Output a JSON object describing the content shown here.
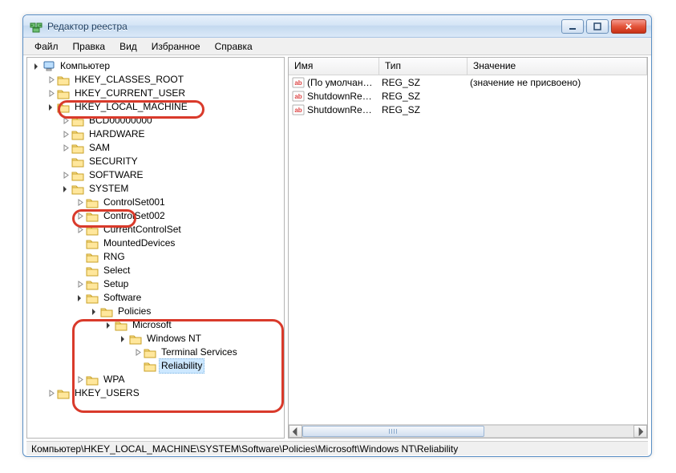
{
  "window": {
    "title": "Редактор реестра"
  },
  "menu": {
    "file": "Файл",
    "edit": "Правка",
    "view": "Вид",
    "favorites": "Избранное",
    "help": "Справка"
  },
  "tree": {
    "root": "Компьютер",
    "hkcr": "HKEY_CLASSES_ROOT",
    "hkcu": "HKEY_CURRENT_USER",
    "hklm": "HKEY_LOCAL_MACHINE",
    "hklm_children": {
      "bcd": "BCD00000000",
      "hardware": "HARDWARE",
      "sam": "SAM",
      "security": "SECURITY",
      "software": "SOFTWARE",
      "system": "SYSTEM"
    },
    "system_children": {
      "cs001": "ControlSet001",
      "cs002": "ControlSet002",
      "ccs": "CurrentControlSet",
      "md": "MountedDevices",
      "rng": "RNG",
      "select": "Select",
      "setup": "Setup",
      "software": "Software",
      "wpa": "WPA"
    },
    "software_children": {
      "policies": "Policies",
      "microsoft": "Microsoft",
      "windowsnt": "Windows NT",
      "ts": "Terminal Services",
      "reliability": "Reliability"
    },
    "hku": "HKEY_USERS"
  },
  "listview": {
    "columns": {
      "name": "Имя",
      "type": "Тип",
      "data": "Значение"
    },
    "col_widths": {
      "name": 113,
      "type": 110,
      "data": 220
    },
    "rows": [
      {
        "name": "(По умолчанию)",
        "type": "REG_SZ",
        "data": "(значение не присвоено)"
      },
      {
        "name": "ShutdownReaso...",
        "type": "REG_SZ",
        "data": ""
      },
      {
        "name": "ShutdownReaso...",
        "type": "REG_SZ",
        "data": ""
      }
    ]
  },
  "statusbar": {
    "path": "Компьютер\\HKEY_LOCAL_MACHINE\\SYSTEM\\Software\\Policies\\Microsoft\\Windows NT\\Reliability"
  }
}
